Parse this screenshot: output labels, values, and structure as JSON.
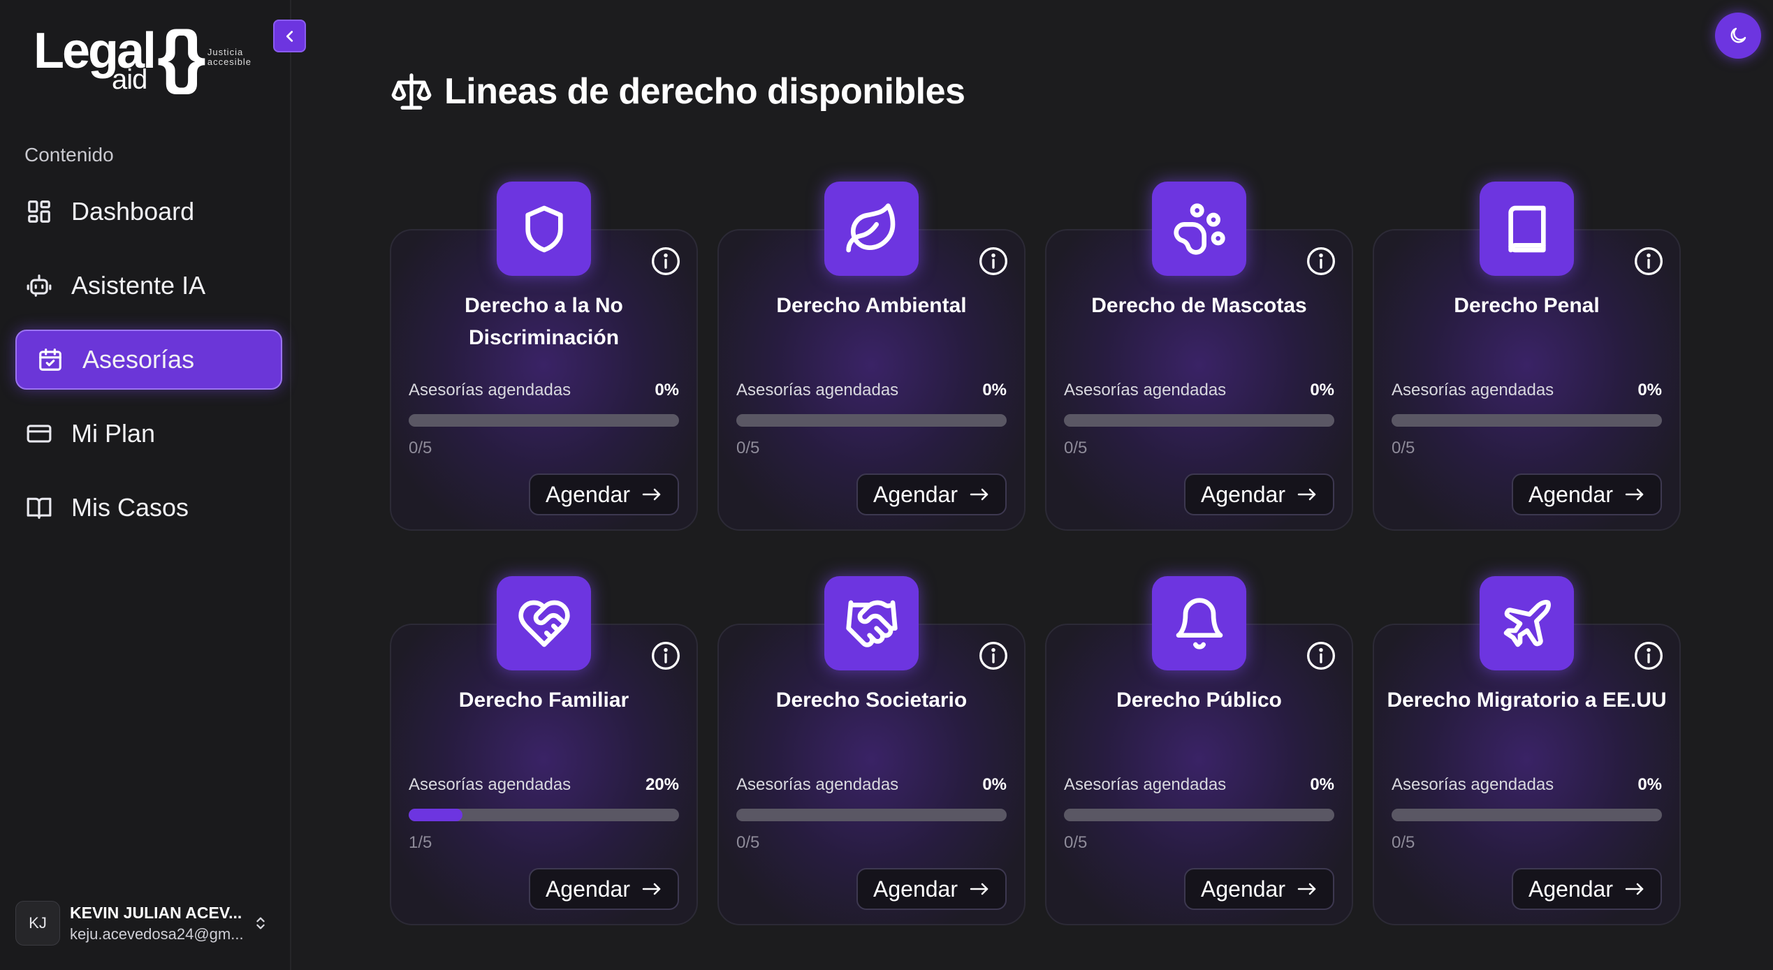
{
  "brand": {
    "word": "Legal",
    "sub": "aid",
    "braces": "{}",
    "tagline_line1": "Justicia",
    "tagline_line2": "accesible"
  },
  "sidebar": {
    "heading": "Contenido",
    "items": [
      {
        "label": "Dashboard",
        "icon": "dashboard-icon",
        "active": false
      },
      {
        "label": "Asistente IA",
        "icon": "bot-icon",
        "active": false
      },
      {
        "label": "Asesorías",
        "icon": "calendar-check-icon",
        "active": true
      },
      {
        "label": "Mi Plan",
        "icon": "credit-card-icon",
        "active": false
      },
      {
        "label": "Mis Casos",
        "icon": "book-open-icon",
        "active": false
      }
    ],
    "user": {
      "initials": "KJ",
      "name": "KEVIN JULIAN ACEV...",
      "email": "keju.acevedosa24@gm..."
    }
  },
  "main": {
    "title": "Lineas de derecho disponibles",
    "title_icon": "scale-icon",
    "progress_label": "Asesorías agendadas",
    "action_label": "Agendar",
    "cards": [
      {
        "title": "Derecho a la No Discriminación",
        "icon": "shield-icon",
        "percent": "0%",
        "progress": 0.0,
        "count": "0/5"
      },
      {
        "title": "Derecho Ambiental",
        "icon": "leaf-icon",
        "percent": "0%",
        "progress": 0.0,
        "count": "0/5"
      },
      {
        "title": "Derecho de Mascotas",
        "icon": "paw-icon",
        "percent": "0%",
        "progress": 0.0,
        "count": "0/5"
      },
      {
        "title": "Derecho Penal",
        "icon": "book-icon",
        "percent": "0%",
        "progress": 0.0,
        "count": "0/5"
      },
      {
        "title": "Derecho Familiar",
        "icon": "heart-handshake-icon",
        "percent": "20%",
        "progress": 0.2,
        "count": "1/5"
      },
      {
        "title": "Derecho Societario",
        "icon": "handshake-icon",
        "percent": "0%",
        "progress": 0.0,
        "count": "0/5"
      },
      {
        "title": "Derecho Público",
        "icon": "bell-icon",
        "percent": "0%",
        "progress": 0.0,
        "count": "0/5"
      },
      {
        "title": "Derecho Migratorio a EE.UU",
        "icon": "plane-icon",
        "percent": "0%",
        "progress": 0.0,
        "count": "0/5"
      }
    ]
  },
  "colors": {
    "accent": "#6d35e0",
    "background": "#1c1c1e",
    "sidebar": "#1a1a1c",
    "track": "#5a5764"
  }
}
